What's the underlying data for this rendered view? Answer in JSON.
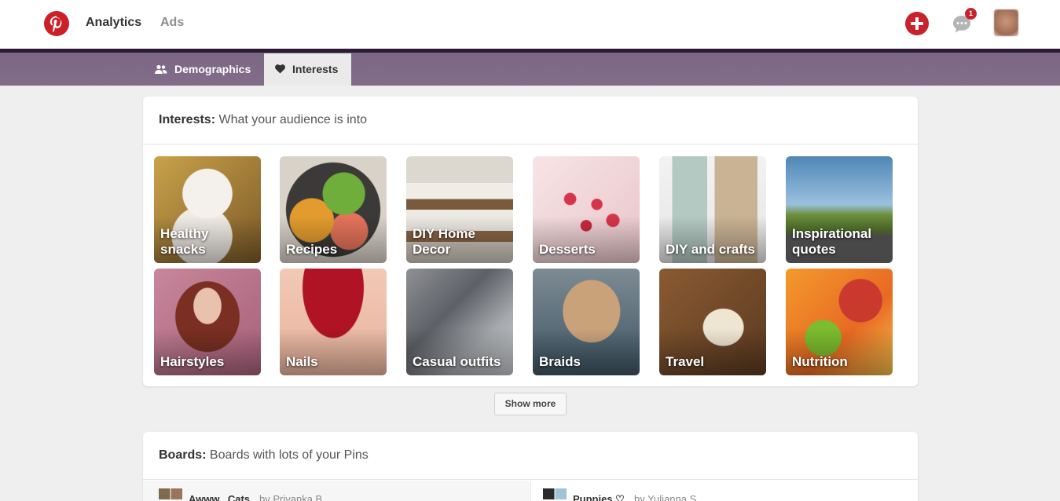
{
  "header": {
    "nav": {
      "analytics": "Analytics",
      "ads": "Ads"
    },
    "notification_count": "1",
    "icons": {
      "logo": "pinterest-logo",
      "add": "plus-icon",
      "messages": "chat-bubble-icon"
    }
  },
  "tabs": [
    {
      "label": "Demographics",
      "icon": "people-icon",
      "selected": false
    },
    {
      "label": "Interests",
      "icon": "heart-icon",
      "selected": true
    }
  ],
  "interests_card": {
    "title": "Interests:",
    "description": "What your audience is into",
    "tiles": [
      {
        "label": "Healthy snacks"
      },
      {
        "label": "Recipes"
      },
      {
        "label": "DIY Home Decor"
      },
      {
        "label": "Desserts"
      },
      {
        "label": "DIY and crafts"
      },
      {
        "label": "Inspirational quotes"
      },
      {
        "label": "Hairstyles"
      },
      {
        "label": "Nails"
      },
      {
        "label": "Casual outfits"
      },
      {
        "label": "Braids"
      },
      {
        "label": "Travel"
      },
      {
        "label": "Nutrition"
      }
    ],
    "show_more_label": "Show more"
  },
  "boards_card": {
    "title": "Boards:",
    "description": "Boards with lots of your Pins",
    "boards": [
      {
        "name": "Awww...Cats",
        "by": "by Priyanka B"
      },
      {
        "name": "Puppies ♡",
        "by": "by Yulianna S"
      }
    ]
  },
  "colors": {
    "brand_red": "#cb2027",
    "band_purple": "#7c6785"
  }
}
